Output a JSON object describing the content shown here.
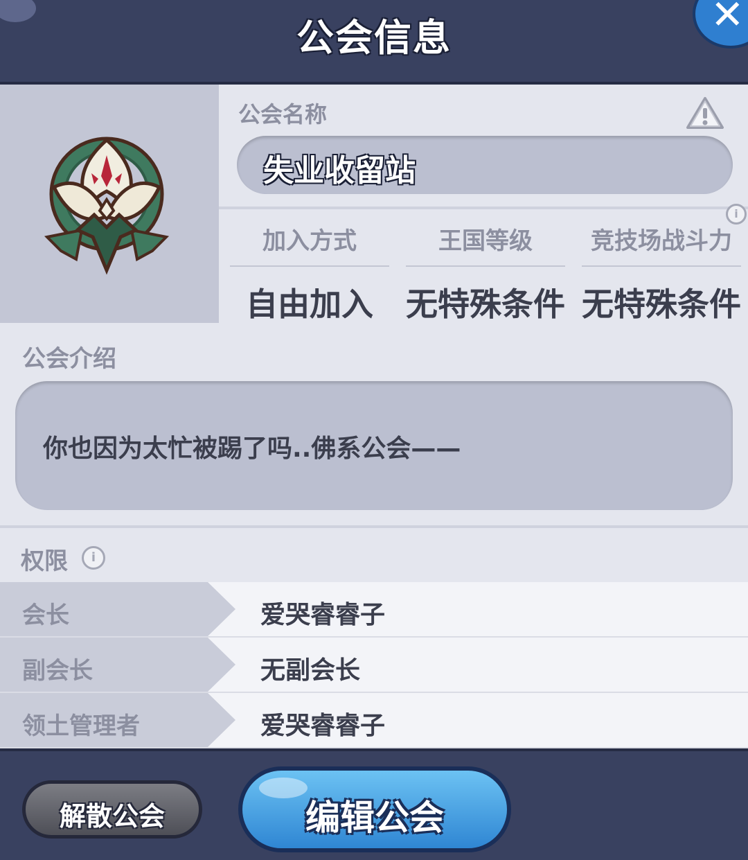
{
  "window": {
    "title": "公会信息"
  },
  "guild": {
    "name_label": "公会名称",
    "name": "失业收留站",
    "stats": [
      {
        "label": "加入方式",
        "value": "自由加入"
      },
      {
        "label": "王国等级",
        "value": "无特殊条件"
      },
      {
        "label": "竞技场战斗力",
        "value": "无特殊条件"
      }
    ],
    "intro_label": "公会介绍",
    "intro_text": "你也因为太忙被踢了吗..佛系公会——"
  },
  "permissions": {
    "label": "权限",
    "rows": [
      {
        "role": "会长",
        "name": "爱哭睿睿子"
      },
      {
        "role": "副会长",
        "name": "无副会长"
      },
      {
        "role": "领土管理者",
        "name": "爱哭睿睿子"
      }
    ]
  },
  "footer": {
    "disband_label": "解散公会",
    "edit_label": "编辑公会"
  },
  "icons": {
    "close": "close-icon",
    "warning": "warning-icon",
    "info": "info-icon",
    "emblem": "guild-emblem"
  },
  "colors": {
    "header": "#394160",
    "panel": "#e4e6ee",
    "edit_button": "#2f86d3",
    "disband_button": "#5e5f67"
  }
}
